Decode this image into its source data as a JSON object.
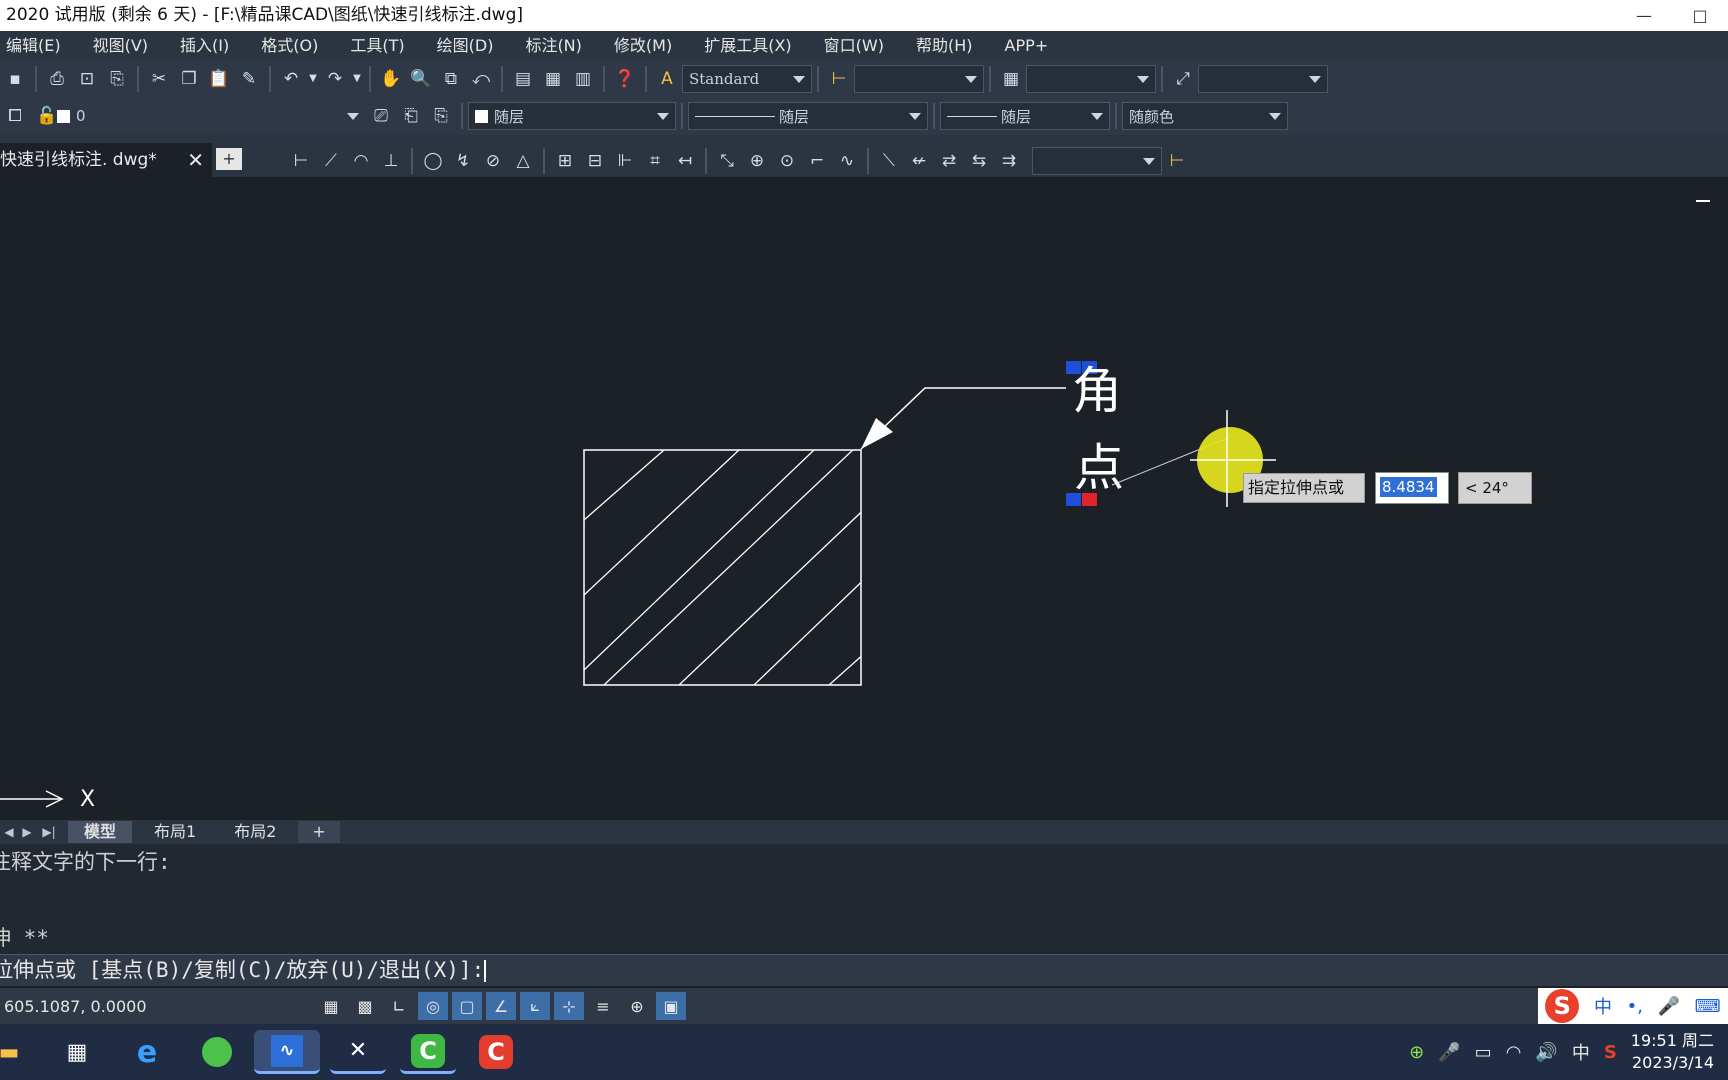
{
  "window": {
    "title": "2020 试用版 (剩余 6 天) - [F:\\精品课CAD\\图纸\\快速引线标注.dwg]",
    "minimize_glyph": "—",
    "restore_glyph": "□"
  },
  "menu": [
    "编辑(E)",
    "视图(V)",
    "插入(I)",
    "格式(O)",
    "工具(T)",
    "绘图(D)",
    "标注(N)",
    "修改(M)",
    "扩展工具(X)",
    "窗口(W)",
    "帮助(H)",
    "APP+"
  ],
  "toolbar1": {
    "text_style": "Standard"
  },
  "toolbar2": {
    "layer_name": "0",
    "color": "随层",
    "linetype": "随层",
    "lineweight": "随层",
    "plot_style": "随颜色"
  },
  "document_tab": {
    "name": "快速引线标注. dwg*",
    "close_glyph": "✕",
    "new_tab_glyph": "+"
  },
  "drawing": {
    "mtext_char1": "角",
    "mtext_char2": "点",
    "axis_label": "X",
    "cursor_angle": "< 24°"
  },
  "dynamic_input": {
    "prompt": "指定拉伸点或",
    "value": "8.4834",
    "angle": "< 24°"
  },
  "layout_tabs": {
    "nav": [
      "◀",
      "▶",
      "▶|"
    ],
    "tabs": [
      "模型",
      "布局1",
      "布局2"
    ],
    "add": "+"
  },
  "command": {
    "history": [
      "注释文字的下一行:",
      "伸 **"
    ],
    "prompt": "拉伸点或 [基点(B)/复制(C)/放弃(U)/退出(X)]:"
  },
  "status": {
    "coordinates": "605.1087, 0.0000"
  },
  "ime": {
    "logo": "S",
    "lang": "中",
    "punct": "•,",
    "mic": "🎤",
    "kbd": "⌨"
  },
  "taskbar": {
    "tray_lang": "中",
    "time": "19:51 周二",
    "date": "2023/3/14"
  },
  "colors": {
    "canvas_bg": "#1c2127",
    "menubar_bg": "#2b3441",
    "grip_blue": "#1f4fd8",
    "grip_red": "#e0242a",
    "cursor_highlight": "#e6e61e",
    "drawing_lines": "#ffffff"
  }
}
